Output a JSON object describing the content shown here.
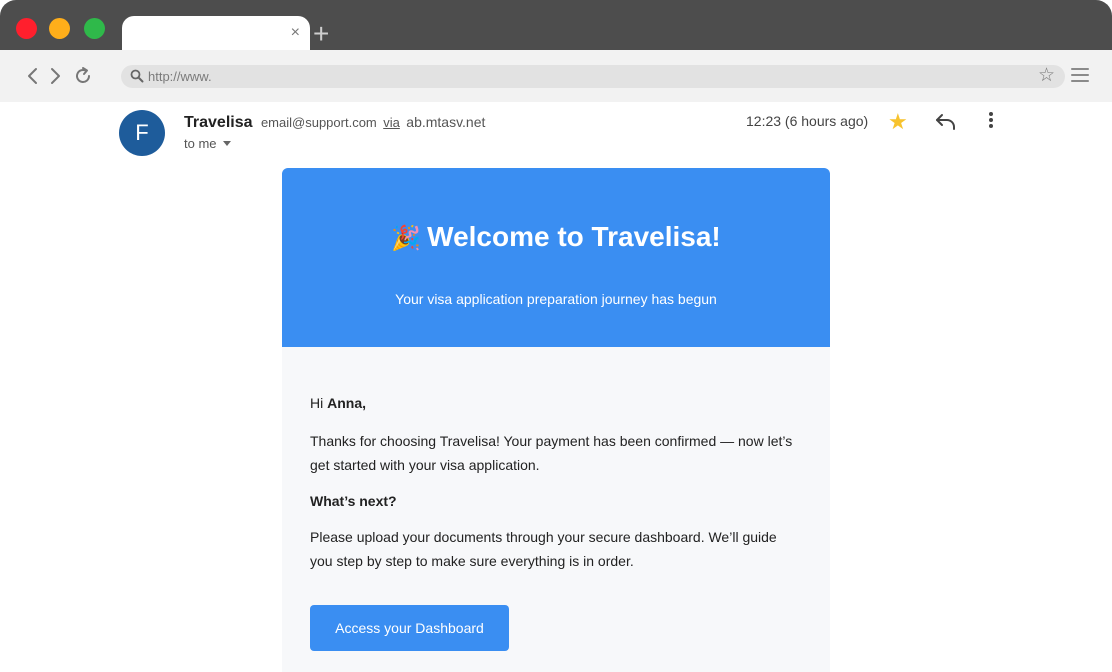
{
  "browser": {
    "tab_close": "×",
    "new_tab": "+",
    "url": "http://www.",
    "bookmark_star": "☆"
  },
  "email_header": {
    "avatar_letter": "F",
    "sender_name": "Travelisa",
    "sender_email": "email@support.com",
    "via_label": "via",
    "via_domain": "ab.mtasv.net",
    "recipient": "to me",
    "timestamp": "12:23 (6 hours ago)",
    "star": "★"
  },
  "email_body": {
    "hero_emoji": "🎉",
    "hero_title": "Welcome to Travelisa!",
    "hero_subtitle": "Your visa application preparation journey has begun",
    "greeting_prefix": "Hi ",
    "greeting_name": "Anna,",
    "paragraph_1": "Thanks for choosing Travelisa! Your payment has been confirmed — now let’s get started with your visa application.",
    "next_title": "What’s next?",
    "paragraph_2": "Please upload your documents through your secure dashboard. We’ll guide you step by step to make sure everything is in order.",
    "cta_label": "Access your Dashboard"
  },
  "colors": {
    "brand_blue": "#3a8ef2",
    "avatar_blue": "#1e5c9b",
    "star_yellow": "#f7c32e",
    "titlebar": "#4d4d4d"
  },
  "icons": [
    "back-icon",
    "forward-icon",
    "reload-icon",
    "search-icon",
    "bookmark-star-icon",
    "menu-icon",
    "star-icon",
    "reply-icon",
    "more-vert-icon"
  ]
}
